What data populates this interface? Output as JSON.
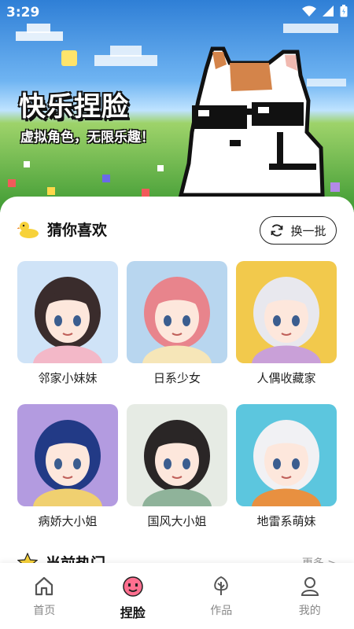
{
  "status_bar": {
    "time": "3:29"
  },
  "banner": {
    "title": "快乐捏脸",
    "subtitle": "虚拟角色，无限乐趣！"
  },
  "recommend": {
    "title": "猜你喜欢",
    "refresh_label": "换一批",
    "items": [
      {
        "label": "邻家小妹妹",
        "bg": "#cfe3f7",
        "hair": "#3a2c2c",
        "accent": "#f3b8c8"
      },
      {
        "label": "日系少女",
        "bg": "#b8d6ef",
        "hair": "#e8848c",
        "accent": "#f6e6b8"
      },
      {
        "label": "人偶收藏家",
        "bg": "#f2c94c",
        "hair": "#e8e8ee",
        "accent": "#c9a0d8"
      },
      {
        "label": "病娇大小姐",
        "bg": "#b39be0",
        "hair": "#223a86",
        "accent": "#f0d070"
      },
      {
        "label": "国风大小姐",
        "bg": "#e6ebe4",
        "hair": "#2a2626",
        "accent": "#8fb39a"
      },
      {
        "label": "地雷系萌妹",
        "bg": "#5cc6de",
        "hair": "#f1f1f4",
        "accent": "#e89040"
      }
    ]
  },
  "hot": {
    "title": "当前热门",
    "more_label": "更多 >"
  },
  "tabs": [
    {
      "label": "首页",
      "icon": "home-icon",
      "active": false
    },
    {
      "label": "捏脸",
      "icon": "face-icon",
      "active": true
    },
    {
      "label": "作品",
      "icon": "tree-icon",
      "active": false
    },
    {
      "label": "我的",
      "icon": "user-icon",
      "active": false
    }
  ],
  "colors": {
    "accent_yellow": "#f7d23a",
    "active_pink": "#ff6f8f"
  }
}
